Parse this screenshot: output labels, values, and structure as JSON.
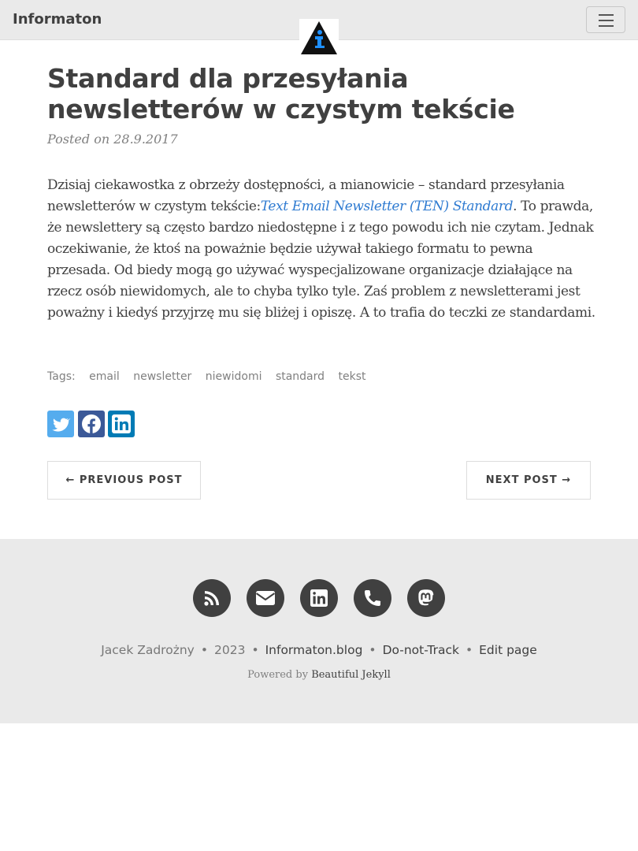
{
  "nav": {
    "brand": "Informaton"
  },
  "post": {
    "title": "Standard dla przesyłania newsletterów w czystym tekście",
    "meta": "Posted on 28.9.2017",
    "paragraph_before": "Dzisiaj ciekawostka z obrzeży dostępności, a mianowicie – standard przesyłania newsletterów w czystym tekście:",
    "link_text": "Text Email Newsletter (TEN) Standard",
    "paragraph_after": ". To prawda, że newslettery są często bardzo niedostępne i z tego powodu ich nie czytam. Jednak oczekiwanie, że ktoś na poważnie będzie używał takiego formatu to pewna przesada. Od biedy mogą go używać wyspecjalizowane organizacje działające na rzecz osób niewidomych, ale to chyba tylko tyle. Zaś problem z newsletterami jest poważny i kiedyś przyjrzę mu się bliżej i opiszę. A to trafia do teczki ze standardami."
  },
  "tags": {
    "label": "Tags:",
    "items": [
      "email",
      "newsletter",
      "niewidomi",
      "standard",
      "tekst"
    ]
  },
  "share": {
    "icons": [
      "twitter-icon",
      "facebook-icon",
      "linkedin-icon"
    ],
    "colors": {
      "twitter": "#55acee",
      "facebook": "#3b5998",
      "linkedin": "#007bb5"
    }
  },
  "pager": {
    "previous": "← PREVIOUS POST",
    "next": "NEXT POST →"
  },
  "footer": {
    "icons": [
      "rss-icon",
      "envelope-icon",
      "linkedin-icon",
      "phone-icon",
      "mastodon-icon"
    ],
    "author": "Jacek Zadrożny",
    "year": "2023",
    "site": "Informaton.blog",
    "dnt": "Do-not-Track",
    "edit": "Edit page",
    "powered_prefix": "Powered by",
    "powered_link": "Beautiful Jekyll",
    "separator": "•"
  },
  "colors": {
    "nav_bg": "#eaeaea",
    "text": "#404040",
    "link": "#2f7bd1",
    "logo_accent": "#1e90ff"
  }
}
